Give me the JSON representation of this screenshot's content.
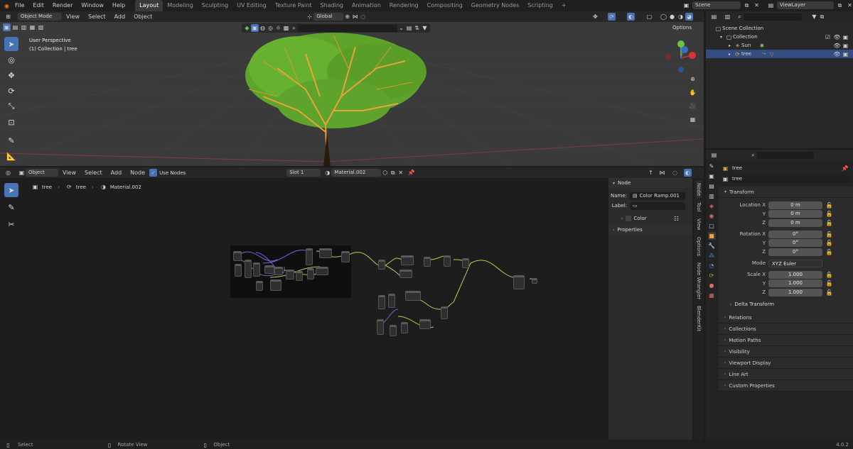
{
  "topbar": {
    "menus": [
      "File",
      "Edit",
      "Render",
      "Window",
      "Help"
    ],
    "workspaces": [
      "Layout",
      "Modeling",
      "Sculpting",
      "UV Editing",
      "Texture Paint",
      "Shading",
      "Animation",
      "Rendering",
      "Compositing",
      "Geometry Nodes",
      "Scripting"
    ],
    "active_workspace": "Layout",
    "add_tab": "+",
    "scene": "Scene",
    "view_layer": "ViewLayer"
  },
  "viewport": {
    "mode": "Object Mode",
    "menus": [
      "View",
      "Select",
      "Add",
      "Object"
    ],
    "transform_orientation": "Global",
    "options": "Options",
    "overlay_line1": "User Perspective",
    "overlay_line2": "(1) Collection | tree"
  },
  "outliner": {
    "items": [
      {
        "label": "Scene Collection",
        "depth": 0
      },
      {
        "label": "Collection",
        "depth": 1
      },
      {
        "label": "Sun",
        "depth": 2
      },
      {
        "label": "tree",
        "depth": 2
      }
    ]
  },
  "node_editor": {
    "type": "Object",
    "menus": [
      "View",
      "Select",
      "Add",
      "Node"
    ],
    "use_nodes": "Use Nodes",
    "slot": "Slot 1",
    "material": "Material.002",
    "breadcrumb": [
      "tree",
      "tree",
      "Material.002"
    ]
  },
  "node_sidebar": {
    "section": "Node",
    "name_label": "Name:",
    "name_value": "Color Ramp.001",
    "label_label": "Label:",
    "color": "Color",
    "properties": "Properties",
    "tabs": [
      "Node",
      "Tool",
      "View",
      "Options",
      "Node Wrangler",
      "BlenderKit"
    ]
  },
  "properties": {
    "object_name": "tree",
    "object_field": "tree",
    "transform": "Transform",
    "location_label": "Location X",
    "rotation_label": "Rotation X",
    "scale_label": "Scale X",
    "y": "Y",
    "z": "Z",
    "location": [
      "0 m",
      "0 m",
      "0 m"
    ],
    "rotation": [
      "0°",
      "0°",
      "0°"
    ],
    "mode_label": "Mode",
    "mode_value": "XYZ Euler",
    "scale": [
      "1.000",
      "1.000",
      "1.000"
    ],
    "sections": [
      "Delta Transform",
      "Relations",
      "Collections",
      "Motion Paths",
      "Visibility",
      "Viewport Display",
      "Line Art",
      "Custom Properties"
    ]
  },
  "statusbar": {
    "items": [
      "Select",
      "Rotate View",
      "Object"
    ],
    "version": "4.0.2"
  },
  "colors": {
    "accent": "#4772b3",
    "panel": "#272727",
    "wire": "#c9c64a"
  }
}
